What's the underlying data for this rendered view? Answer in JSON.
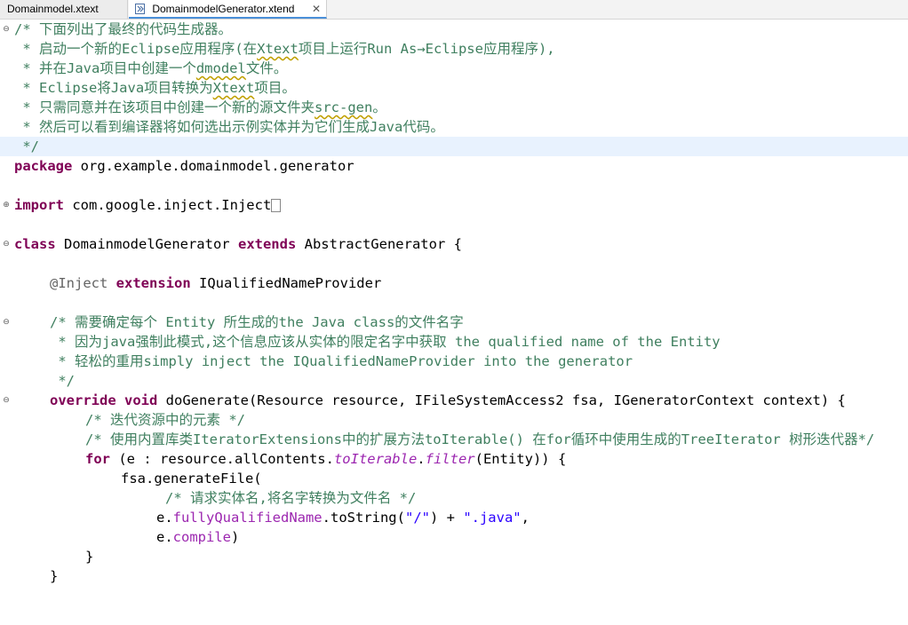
{
  "tabs": [
    {
      "label": "Domainmodel.xtext",
      "active": false
    },
    {
      "label": "DomainmodelGenerator.xtend",
      "active": true,
      "close": "✕"
    }
  ],
  "code": {
    "l1": "/* 下面列出了最终的代码生成器。",
    "l2a": " * 启动一个新的Eclipse应用程序(在",
    "l2b": "Xtext",
    "l2c": "项目上运行Run As→Eclipse应用程序),",
    "l3a": " * 并在Java项目中创建一个",
    "l3b": "dmodel",
    "l3c": "文件。",
    "l4a": " * Eclipse将Java项目转换为",
    "l4b": "Xtext",
    "l4c": "项目。",
    "l5a": " * 只需同意并在该项目中创建一个新的源文件夹",
    "l5b": "src-gen",
    "l5c": "。",
    "l6": " * 然后可以看到编译器将如何选出示例实体并为它们生成Java代码。",
    "l7": " */",
    "pkg_kw": "package",
    "pkg_name": " org.example.domainmodel.generator",
    "imp_kw": "import",
    "imp_name": " com.google.inject.Inject",
    "class_kw": "class",
    "class_name": " DomainmodelGenerator ",
    "extends_kw": "extends",
    "super_name": " AbstractGenerator {",
    "inject_ann": "@Inject",
    "extension_kw": "extension",
    "inject_type": " IQualifiedNameProvider",
    "c2_1": "/* 需要确定每个 Entity 所生成的the Java class的文件名字",
    "c2_2": " * 因为java强制此模式,这个信息应该从实体的限定名字中获取 the qualified name of the Entity",
    "c2_3": " * 轻松的重用simply inject the IQualifiedNameProvider into the generator",
    "c2_4": " */",
    "override_kw": "override",
    "void_kw": "void",
    "method_sig": " doGenerate(Resource resource, IFileSystemAccess2 fsa, IGeneratorContext context) {",
    "c3": "/* 迭代资源中的元素 */",
    "c4": "/* 使用内置库类IteratorExtensions中的扩展方法toIterable() 在for循环中使用生成的TreeIterator 树形迭代器*/",
    "for_kw": "for",
    "for_a": " (e : resource.allContents.",
    "for_toIterable": "toIterable",
    "for_dot": ".",
    "for_filter": "filter",
    "for_b": "(Entity)) {",
    "gen_call": "fsa.generateFile(",
    "c5": "/* 请求实体名,将名字转换为文件名 */",
    "e_dot": "e.",
    "fqn": "fullyQualifiedName",
    "tostr": ".toString(",
    "str_slash": "\"/\"",
    "plus": ") + ",
    "str_java": "\".java\"",
    "comma": ",",
    "e_dot2": "e.",
    "compile": "compile",
    "close_paren": ")",
    "brace": "}",
    "brace2": "}"
  },
  "fold_icons": {
    "minus": "⊖",
    "plus": "⊕"
  }
}
